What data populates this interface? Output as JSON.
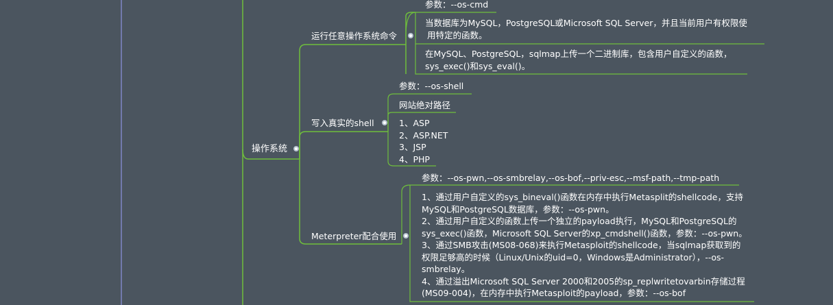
{
  "colors": {
    "background": "#4b555f",
    "branch": "#6fbf3c",
    "left_guide": "#7f86c5",
    "text": "#ffffff"
  },
  "root": {
    "label": "操作系统"
  },
  "branches": [
    {
      "label": "运行任意操作系统命令",
      "param": "参数：--os-cmd",
      "items": [
        {
          "lines": [
            "当数据库为MySQL，PostgreSQL或Microsoft SQL Server，并且当前用户有权限使",
            "用特定的函数。"
          ]
        },
        {
          "lines": [
            "在MySQL、PostgreSQL，sqlmap上传一个二进制库，包含用户自定义的函数，",
            "sys_exec()和sys_eval()。"
          ]
        }
      ]
    },
    {
      "label": "写入真实的shell",
      "param": "参数：--os-shell",
      "path_title": "网站绝对路径",
      "list": [
        "1、ASP",
        "2、ASP.NET",
        "3、JSP",
        "4、PHP"
      ]
    },
    {
      "label": "Meterpreter配合使用",
      "param": "参数：--os-pwn,--os-smbrelay,--os-bof,--priv-esc,--msf-path,--tmp-path",
      "lines": [
        "1、通过用户自定义的sys_bineval()函数在内存中执行Metasplit的shellcode，支持",
        "MySQL和PostgreSQL数据库，参数：--os-pwn。",
        "2、通过用户自定义的函数上传一个独立的payload执行，MySQL和PostgreSQL的",
        "sys_exec()函数，Microsoft SQL Server的xp_cmdshell()函数，参数：--os-pwn。",
        "3、通过SMB攻击(MS08-068)来执行Metasploit的shellcode，当sqlmap获取到的",
        "权限足够高的时候（Linux/Unix的uid=0，Windows是Administrator），--os-",
        "smbrelay。",
        "4、通过溢出Microsoft SQL Server 2000和2005的sp_replwritetovarbin存储过程",
        "(MS09-004)，在内存中执行Metasploit的payload，参数：--os-bof"
      ]
    }
  ]
}
